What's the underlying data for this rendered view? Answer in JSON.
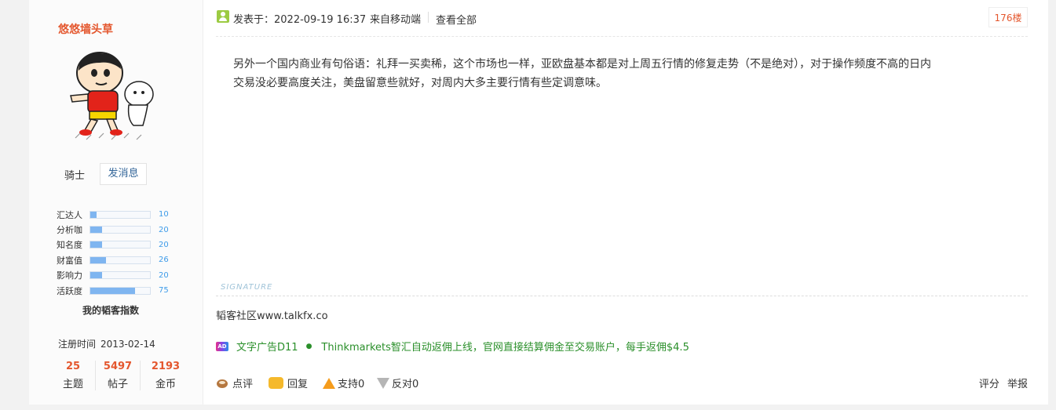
{
  "author": {
    "name": "悠悠墙头草",
    "rank": "骑士",
    "send_message": "发消息",
    "stats": [
      {
        "name": "汇达人",
        "value": "10",
        "level": 0.1
      },
      {
        "name": "分析咖",
        "value": "20",
        "level": 0.2
      },
      {
        "name": "知名度",
        "value": "20",
        "level": 0.2
      },
      {
        "name": "财富值",
        "value": "26",
        "level": 0.26
      },
      {
        "name": "影响力",
        "value": "20",
        "level": 0.2
      },
      {
        "name": "活跃度",
        "value": "75",
        "level": 0.75
      }
    ],
    "index_label": "我的韬客指数",
    "register_label": "注册时间",
    "register_date": "2013-02-14",
    "counts": [
      {
        "num": "25",
        "label": "主题"
      },
      {
        "num": "5497",
        "label": "帖子"
      },
      {
        "num": "2193",
        "label": "金币"
      }
    ]
  },
  "post": {
    "posted": "发表于：2022-09-19 16:37",
    "from": "来自移动端",
    "view_all": "查看全部",
    "floor": "176楼",
    "content": "另外一个国内商业有句俗语：礼拜一买卖稀，这个市场也一样，亚欧盘基本都是对上周五行情的修复走势（不是绝对），对于操作频度不高的日内交易没必要高度关注，美盘留意些就好，对周内大多主要行情有些定调意味。",
    "signature_label": "SIGNATURE",
    "signature_text": "韬客社区www.talkfx.co",
    "ad": {
      "icon_text": "AD",
      "label": "文字广告D11",
      "text": "Thinkmarkets智汇自动返佣上线，官网直接结算佣金至交易账户，每手返佣$4.5"
    },
    "actions": {
      "comment": "点评",
      "reply": "回复",
      "support": "支持0",
      "oppose": "反对0",
      "rate": "评分",
      "report": "举报"
    }
  },
  "colors": {
    "accent": "#e4572e",
    "link": "#336699",
    "ad": "#2a8f2a",
    "bar": "#7fb5f0"
  }
}
